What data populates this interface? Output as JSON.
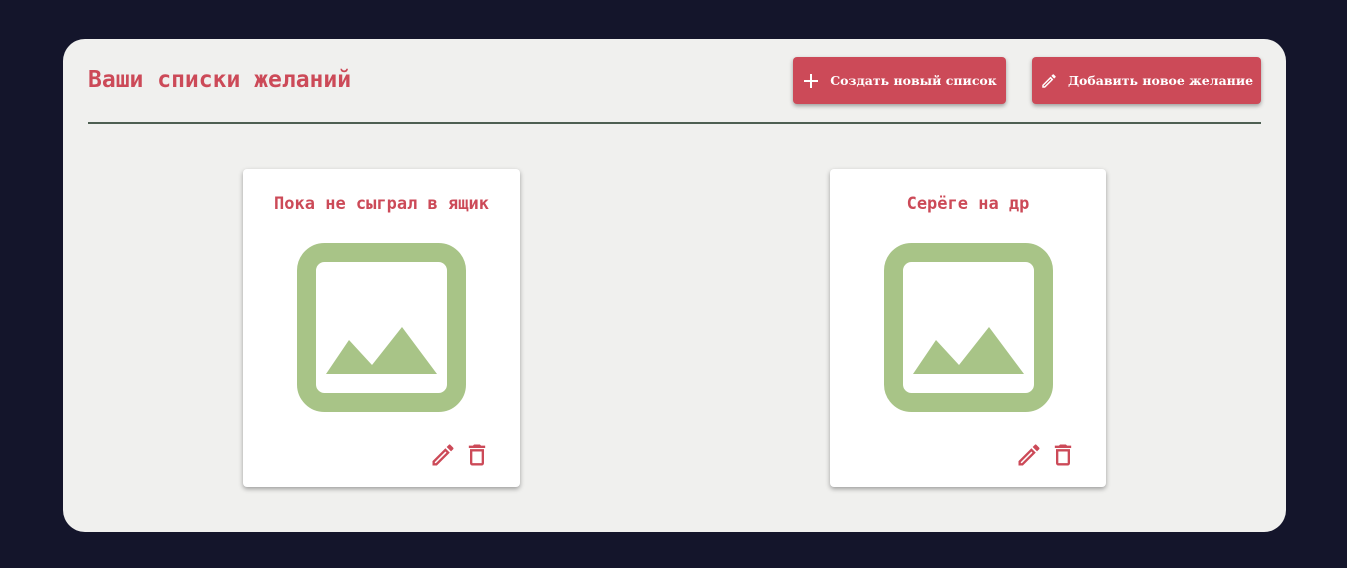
{
  "header": {
    "title": "Ваши списки желаний",
    "create_list_label": "Создать новый список",
    "add_wish_label": "Добавить новое желание"
  },
  "wishlists": [
    {
      "title": "Пока не сыграл в ящик"
    },
    {
      "title": "Серёге на др"
    }
  ],
  "colors": {
    "background": "#14152b",
    "panel": "#f0f0ee",
    "accent": "#cc4a58",
    "placeholder": "#a8c487",
    "divider": "#4e5f52"
  },
  "icons": {
    "create": "plus-icon",
    "add": "pencil-icon",
    "edit": "pencil-icon",
    "delete": "trash-icon",
    "placeholder": "image-placeholder-icon"
  }
}
